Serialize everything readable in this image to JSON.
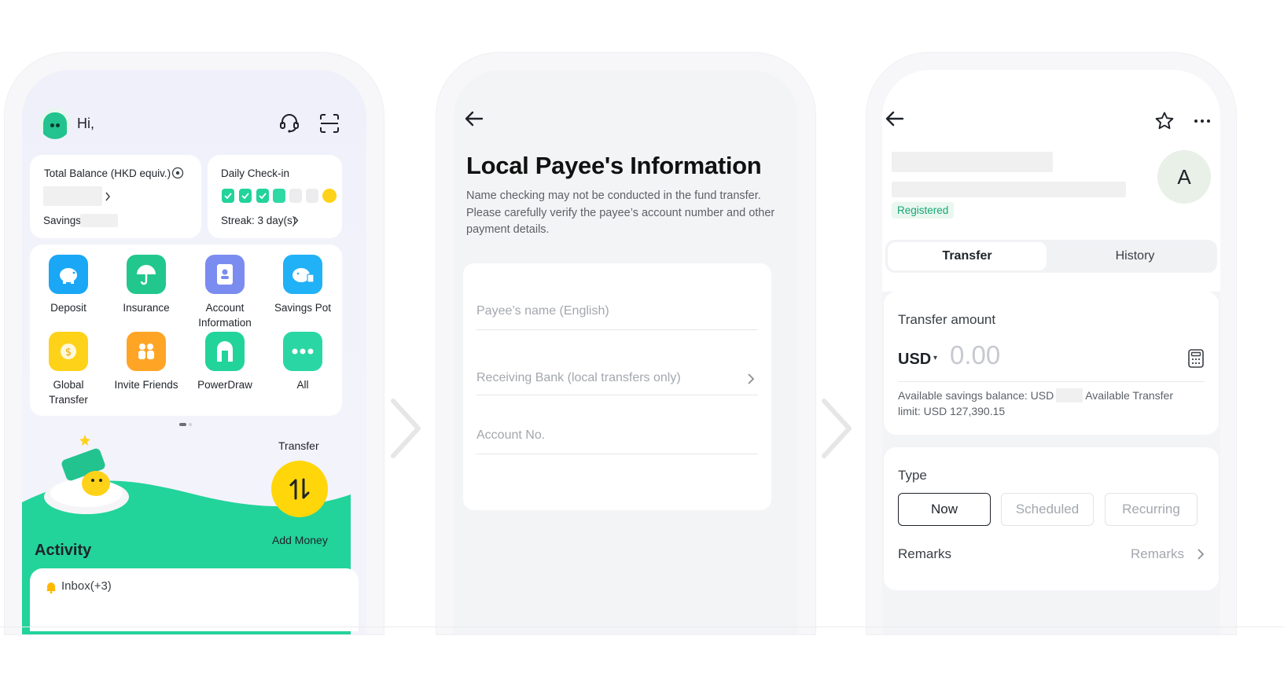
{
  "screen1": {
    "greeting": "Hi,",
    "balance_label": "Total Balance (HKD equiv.)",
    "savings_label": "Savings",
    "checkin_label": "Daily Check-in",
    "streak_label": "Streak: 3 day(s)",
    "tiles": [
      {
        "label": "Deposit",
        "icon": "piggy-bank-icon",
        "color": "#1aa7f5"
      },
      {
        "label": "Insurance",
        "icon": "umbrella-icon",
        "color": "#22c78e"
      },
      {
        "label": "Account Information",
        "icon": "account-card-icon",
        "color": "#7b8cf0"
      },
      {
        "label": "Savings Pot",
        "icon": "savings-pot-icon",
        "color": "#21b1f7"
      },
      {
        "label": "Global Transfer",
        "icon": "global-transfer-icon",
        "color": "#ffd21a"
      },
      {
        "label": "Invite Friends",
        "icon": "invite-friends-icon",
        "color": "#ffa526"
      },
      {
        "label": "PowerDraw",
        "icon": "powerdraw-icon",
        "color": "#22d39a"
      },
      {
        "label": "All",
        "icon": "more-dots-icon",
        "color": "#2ad7a4"
      }
    ],
    "transfer_label": "Transfer",
    "add_money_label": "Add Money",
    "activity_title": "Activity",
    "inbox_label": "Inbox(+3)"
  },
  "screen2": {
    "title": "Local Payee's Information",
    "description": "Name checking may not be conducted in the fund transfer. Please carefully verify the payee’s account number and other payment details.",
    "fields": {
      "payee_name_placeholder": "Payee’s name (English)",
      "bank_placeholder": "Receiving Bank (local transfers only)",
      "account_placeholder": "Account No."
    }
  },
  "screen3": {
    "avatar_letter": "A",
    "status_badge": "Registered",
    "tabs": {
      "transfer": "Transfer",
      "history": "History"
    },
    "amount_label": "Transfer amount",
    "currency": "USD",
    "amount_placeholder": "0.00",
    "available_prefix": "Available savings balance: USD",
    "available_suffix": "Available Transfer limit: USD 127,390.15",
    "type_label": "Type",
    "type_options": {
      "now": "Now",
      "scheduled": "Scheduled",
      "recurring": "Recurring"
    },
    "remarks_label": "Remarks",
    "remarks_placeholder": "Remarks"
  },
  "colors": {
    "brand_green": "#22d39a",
    "accent_yellow": "#ffd60a",
    "registered_green": "#17a773"
  }
}
